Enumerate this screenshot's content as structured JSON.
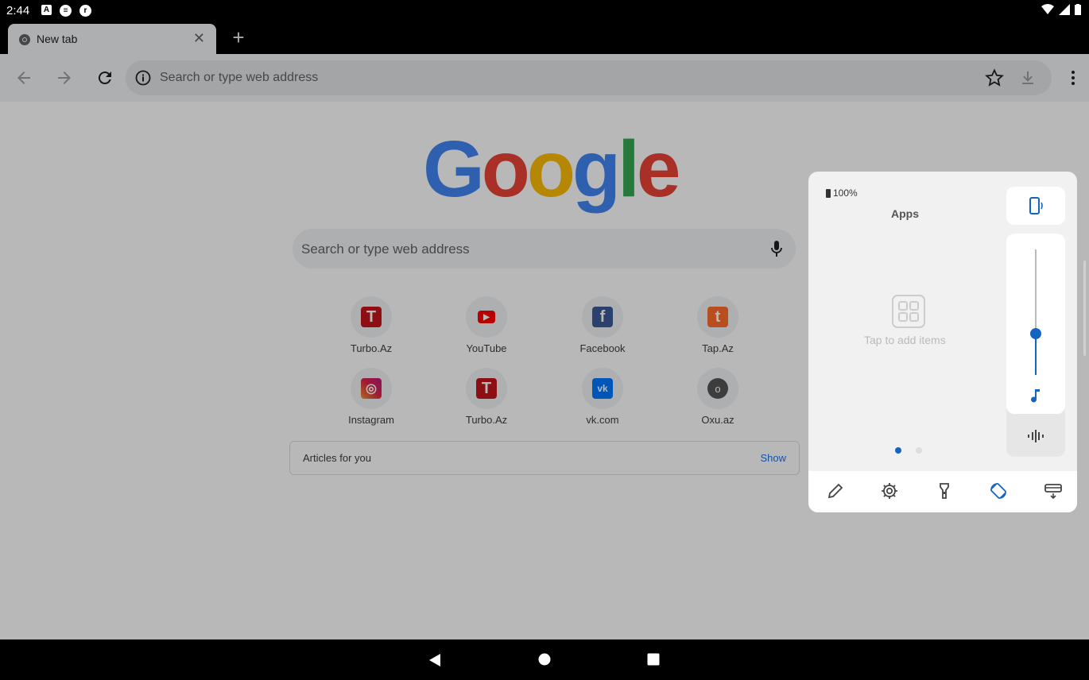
{
  "status_bar": {
    "time": "2:44",
    "left_icons": [
      "A",
      "≡",
      "r"
    ]
  },
  "browser": {
    "tab": {
      "title": "New tab"
    },
    "omnibox": {
      "placeholder": "Search or type web address"
    }
  },
  "ntp": {
    "logo_letters": [
      {
        "char": "G",
        "color": "#4285F4"
      },
      {
        "char": "o",
        "color": "#EA4335"
      },
      {
        "char": "o",
        "color": "#FBBC05"
      },
      {
        "char": "g",
        "color": "#4285F4"
      },
      {
        "char": "l",
        "color": "#34A853"
      },
      {
        "char": "e",
        "color": "#EA4335"
      }
    ],
    "search_placeholder": "Search or type web address",
    "tiles": [
      {
        "label": "Turbo.Az",
        "icon": "T",
        "color": "#c4161c"
      },
      {
        "label": "YouTube",
        "icon": "▶",
        "color": "#ff0000"
      },
      {
        "label": "Facebook",
        "icon": "f",
        "color": "#3b5998"
      },
      {
        "label": "Tap.Az",
        "icon": "t",
        "color": "#ff6b2c"
      },
      {
        "label": "Instagram",
        "icon": "◎",
        "color": "#c13584"
      },
      {
        "label": "Turbo.Az",
        "icon": "T",
        "color": "#c4161c"
      },
      {
        "label": "vk.com",
        "icon": "vk",
        "color": "#0077ff"
      },
      {
        "label": "Oxu.az",
        "icon": "o",
        "color": "#555555"
      }
    ],
    "articles": {
      "title": "Articles for you",
      "action": "Show"
    }
  },
  "volume_panel": {
    "battery": "100%",
    "title": "Apps",
    "empty_text": "Tap to add items",
    "page_count": 2,
    "active_page": 0,
    "media_volume": 0.33,
    "accent": "#1565c0"
  }
}
